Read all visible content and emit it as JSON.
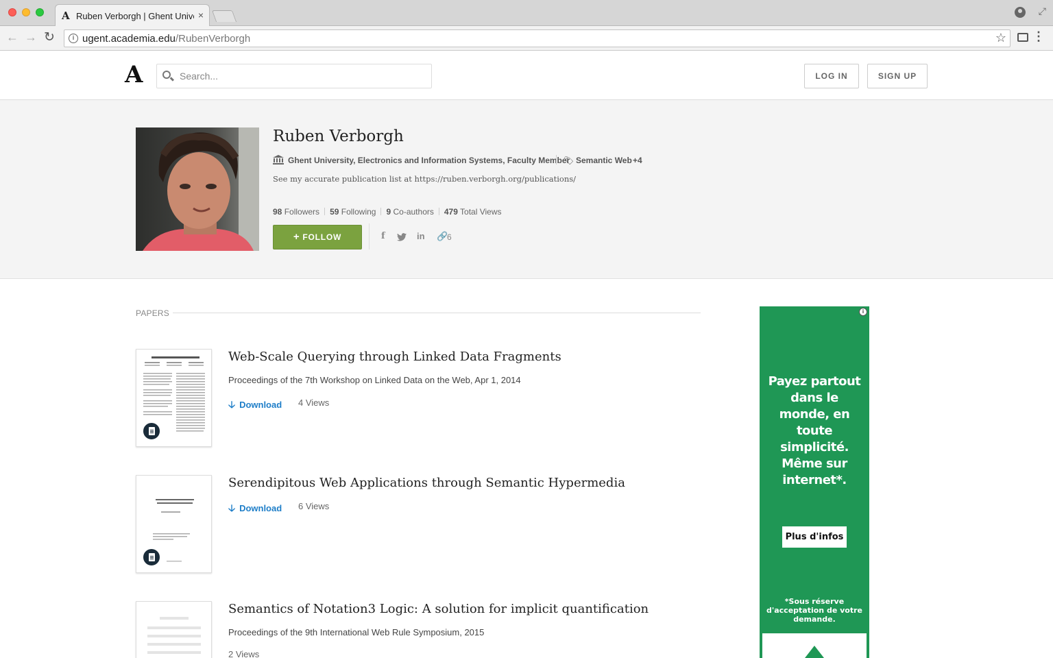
{
  "browser": {
    "tab_title": "Ruben Verborgh | Ghent University",
    "tab_favicon": "A",
    "tab_close": "×",
    "url_host": "ugent.academia.edu",
    "url_path": "/RubenVerborgh"
  },
  "header": {
    "logo": "A",
    "search_placeholder": "Search...",
    "login_label": "LOG IN",
    "signup_label": "SIGN UP"
  },
  "profile": {
    "name": "Ruben Verborgh",
    "affiliation": "Ghent University, Electronics and Information Systems, Faculty Member",
    "research_tag": "Semantic Web",
    "research_more": "+4",
    "bio": "See my accurate publication list at https://ruben.verborgh.org/publications/",
    "followers_count": "98",
    "followers_label": "Followers",
    "following_count": "59",
    "following_label": "Following",
    "coauthors_count": "9",
    "coauthors_label": "Co-authors",
    "views_count": "479",
    "views_label": "Total Views",
    "follow_label": "FOLLOW",
    "links_count": "6"
  },
  "papers": {
    "section_label": "PAPERS",
    "items": [
      {
        "title": "Web-Scale Querying through Linked Data Fragments",
        "venue": "Proceedings of the 7th Workshop on Linked Data on the Web, Apr 1, 2014",
        "download_label": "Download",
        "views": "4 Views"
      },
      {
        "title": "Serendipitous Web Applications through Semantic Hypermedia",
        "venue": "",
        "download_label": "Download",
        "views": "6 Views"
      },
      {
        "title": "Semantics of Notation3 Logic: A solution for implicit quantification",
        "venue": "Proceedings of the 9th International Web Rule Symposium, 2015",
        "download_label": "",
        "views": "2 Views"
      }
    ]
  },
  "ad": {
    "headline": "Payez partout dans le monde, en toute simplicité. Même sur internet*.",
    "cta": "Plus d'infos",
    "disclaimer": "*Sous réserve d'acceptation de votre demande.",
    "background_color": "#1f9755"
  },
  "colors": {
    "follow_button": "#7ba23f",
    "download_link": "#1e7ec8"
  }
}
